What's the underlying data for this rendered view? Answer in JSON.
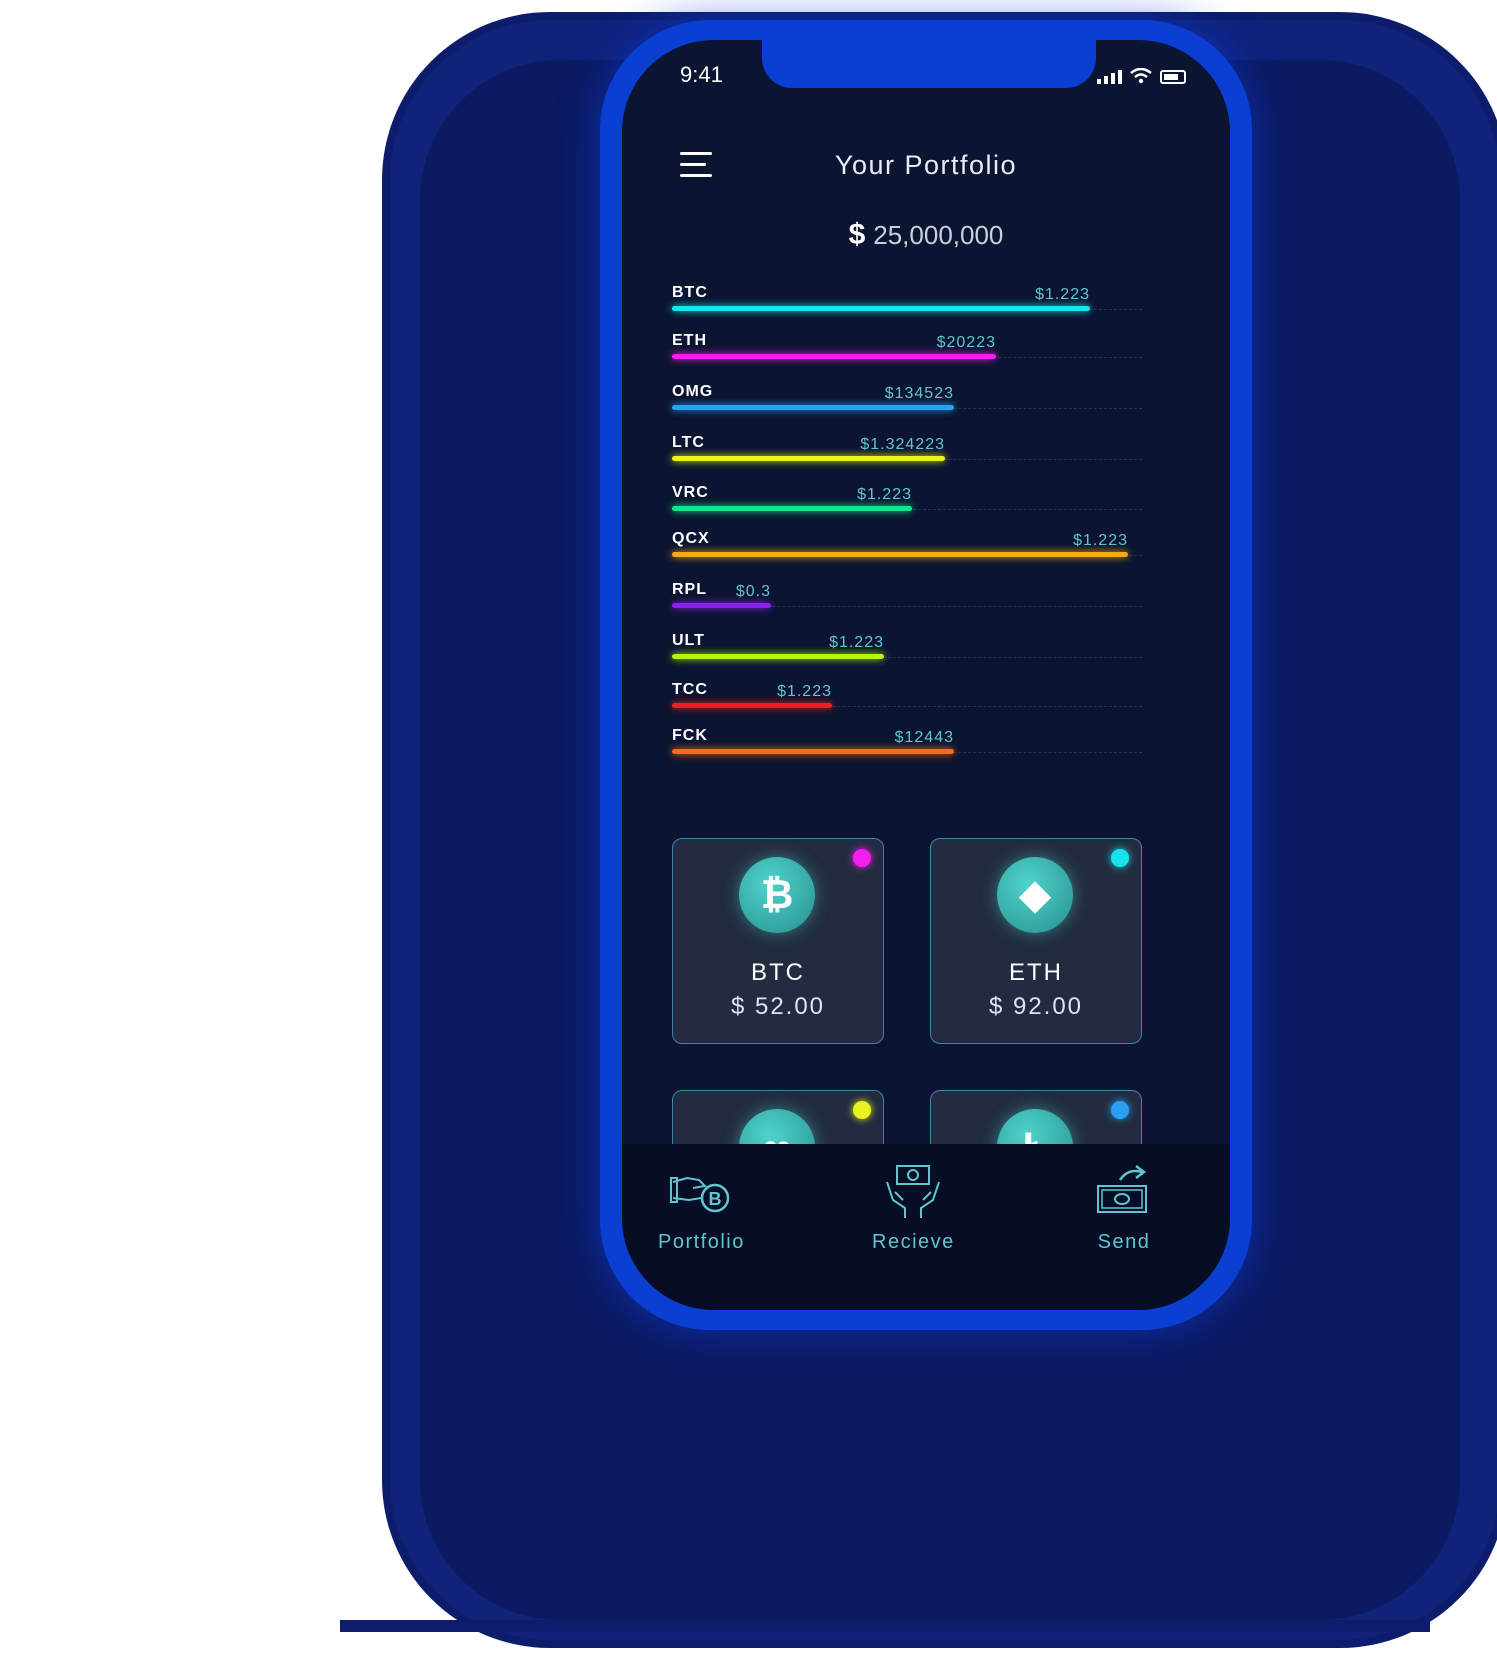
{
  "status_bar": {
    "time": "9:41"
  },
  "header": {
    "title": "Your Portfolio"
  },
  "total": {
    "currency_symbol": "$",
    "amount": "25,000,000"
  },
  "holdings": [
    {
      "symbol": "BTC",
      "value": "$1.223",
      "level": 0.89,
      "color": "#19e3ec"
    },
    {
      "symbol": "ETH",
      "value": "$20223",
      "level": 0.69,
      "color": "#f21ff0"
    },
    {
      "symbol": "OMG",
      "value": "$134523",
      "level": 0.6,
      "color": "#2aa0f2"
    },
    {
      "symbol": "LTC",
      "value": "$1.324223",
      "level": 0.58,
      "color": "#e9f31d"
    },
    {
      "symbol": "VRC",
      "value": "$1.223",
      "level": 0.51,
      "color": "#19e38c"
    },
    {
      "symbol": "QCX",
      "value": "$1.223",
      "level": 0.97,
      "color": "#f7a91a"
    },
    {
      "symbol": "RPL",
      "value": "$0.3",
      "level": 0.21,
      "color": "#8b21f0"
    },
    {
      "symbol": "ULT",
      "value": "$1.223",
      "level": 0.45,
      "color": "#b2f51b"
    },
    {
      "symbol": "TCC",
      "value": "$1.223",
      "level": 0.34,
      "color": "#f21d24"
    },
    {
      "symbol": "FCK",
      "value": "$12443",
      "level": 0.6,
      "color": "#fb6a1a"
    }
  ],
  "cards": [
    {
      "name": "BTC",
      "price": "$ 52.00",
      "icon": "bitcoin-icon",
      "dot_color": "#f21ff0"
    },
    {
      "name": "ETH",
      "price": "$ 92.00",
      "icon": "ethereum-icon",
      "dot_color": "#19e3ec"
    },
    {
      "name": "",
      "price": "",
      "icon": "coin-icon",
      "dot_color": "#e9f31d"
    },
    {
      "name": "",
      "price": "",
      "icon": "litecoin-icon",
      "dot_color": "#2aa0f2"
    }
  ],
  "nav": {
    "portfolio": "Portfolio",
    "receive": "Recieve",
    "send": "Send"
  },
  "colors": {
    "accent": "#5fc6d0",
    "phone_frame": "#0a3fd1",
    "screen_bg": "#0b1430"
  }
}
